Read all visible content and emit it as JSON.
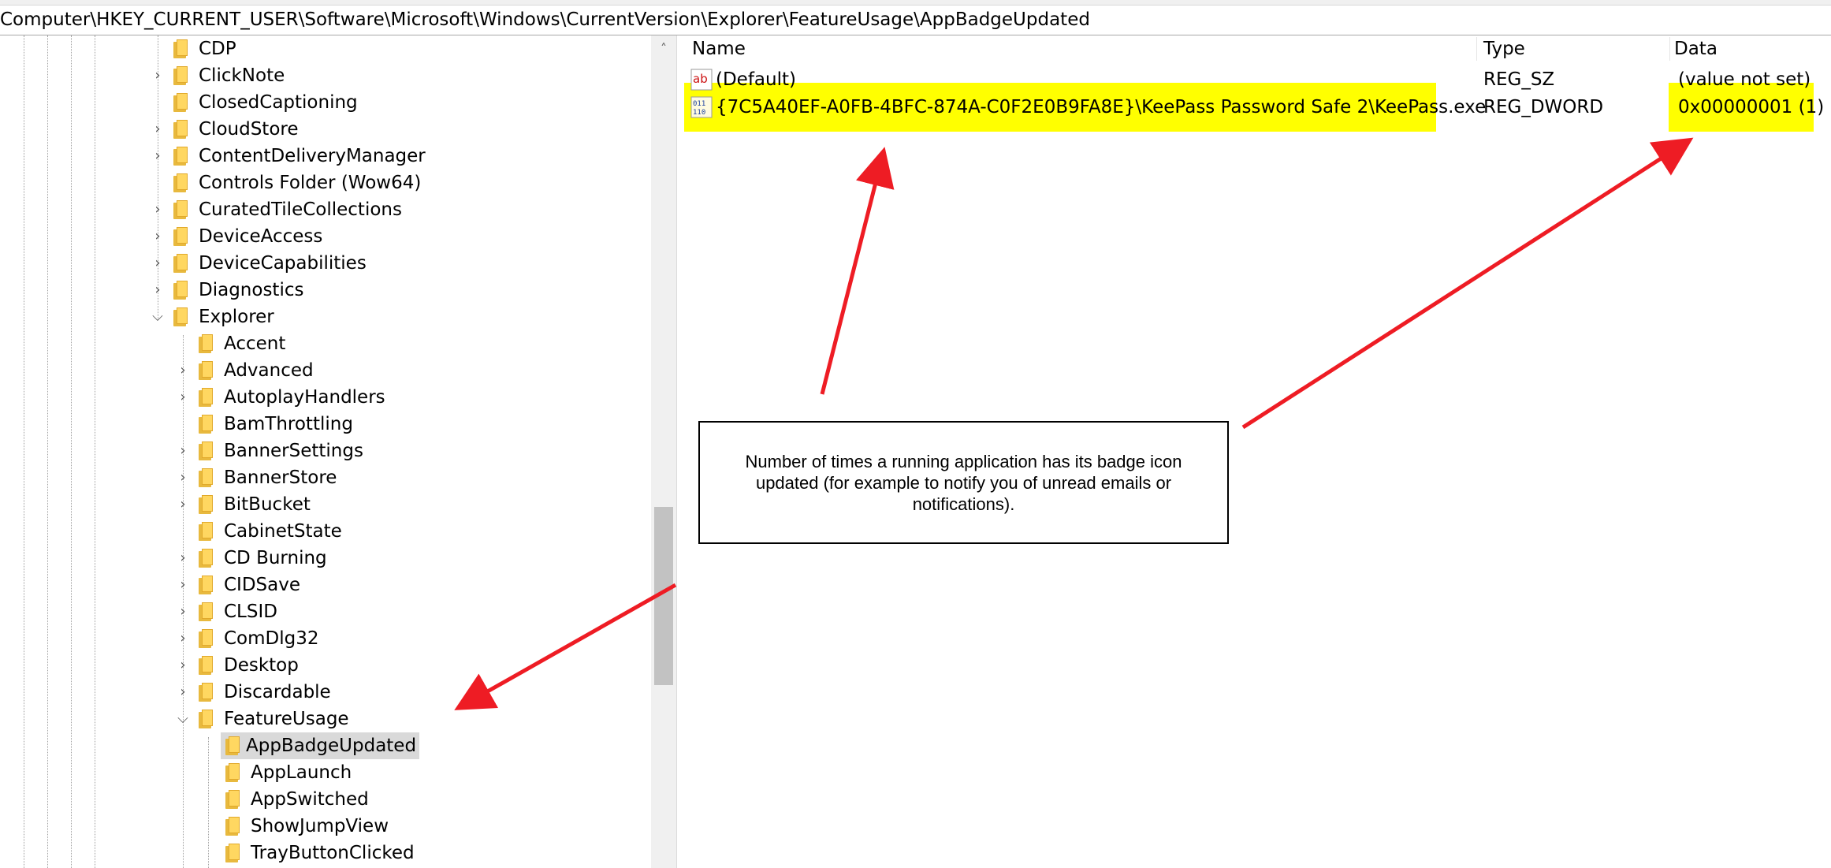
{
  "address": "Computer\\HKEY_CURRENT_USER\\Software\\Microsoft\\Windows\\CurrentVersion\\Explorer\\FeatureUsage\\AppBadgeUpdated",
  "tree": {
    "level1": [
      "CDP",
      "ClickNote",
      "ClosedCaptioning",
      "CloudStore",
      "ContentDeliveryManager",
      "Controls Folder (Wow64)",
      "CuratedTileCollections",
      "DeviceAccess",
      "DeviceCapabilities",
      "Diagnostics",
      "Explorer"
    ],
    "level2": [
      "Accent",
      "Advanced",
      "AutoplayHandlers",
      "BamThrottling",
      "BannerSettings",
      "BannerStore",
      "BitBucket",
      "CabinetState",
      "CD Burning",
      "CIDSave",
      "CLSID",
      "ComDlg32",
      "Desktop",
      "Discardable",
      "FeatureUsage"
    ],
    "level3": [
      "AppBadgeUpdated",
      "AppLaunch",
      "AppSwitched",
      "ShowJumpView",
      "TrayButtonClicked"
    ]
  },
  "columns": {
    "name": "Name",
    "type": "Type",
    "data": "Data"
  },
  "values": [
    {
      "name": "(Default)",
      "type": "REG_SZ",
      "data": "(value not set)",
      "icon": "string-value-icon"
    },
    {
      "name": "{7C5A40EF-A0FB-4BFC-874A-C0F2E0B9FA8E}\\KeePass Password Safe 2\\KeePass.exe",
      "type": "REG_DWORD",
      "data": "0x00000001 (1)",
      "icon": "binary-value-icon"
    }
  ],
  "annotation": "Number of times a running application has its badge icon updated (for example to notify you of unread emails or notifications).",
  "colors": {
    "highlight": "#ffff00",
    "arrow": "#ee1c24",
    "folder": "#ffd761"
  }
}
